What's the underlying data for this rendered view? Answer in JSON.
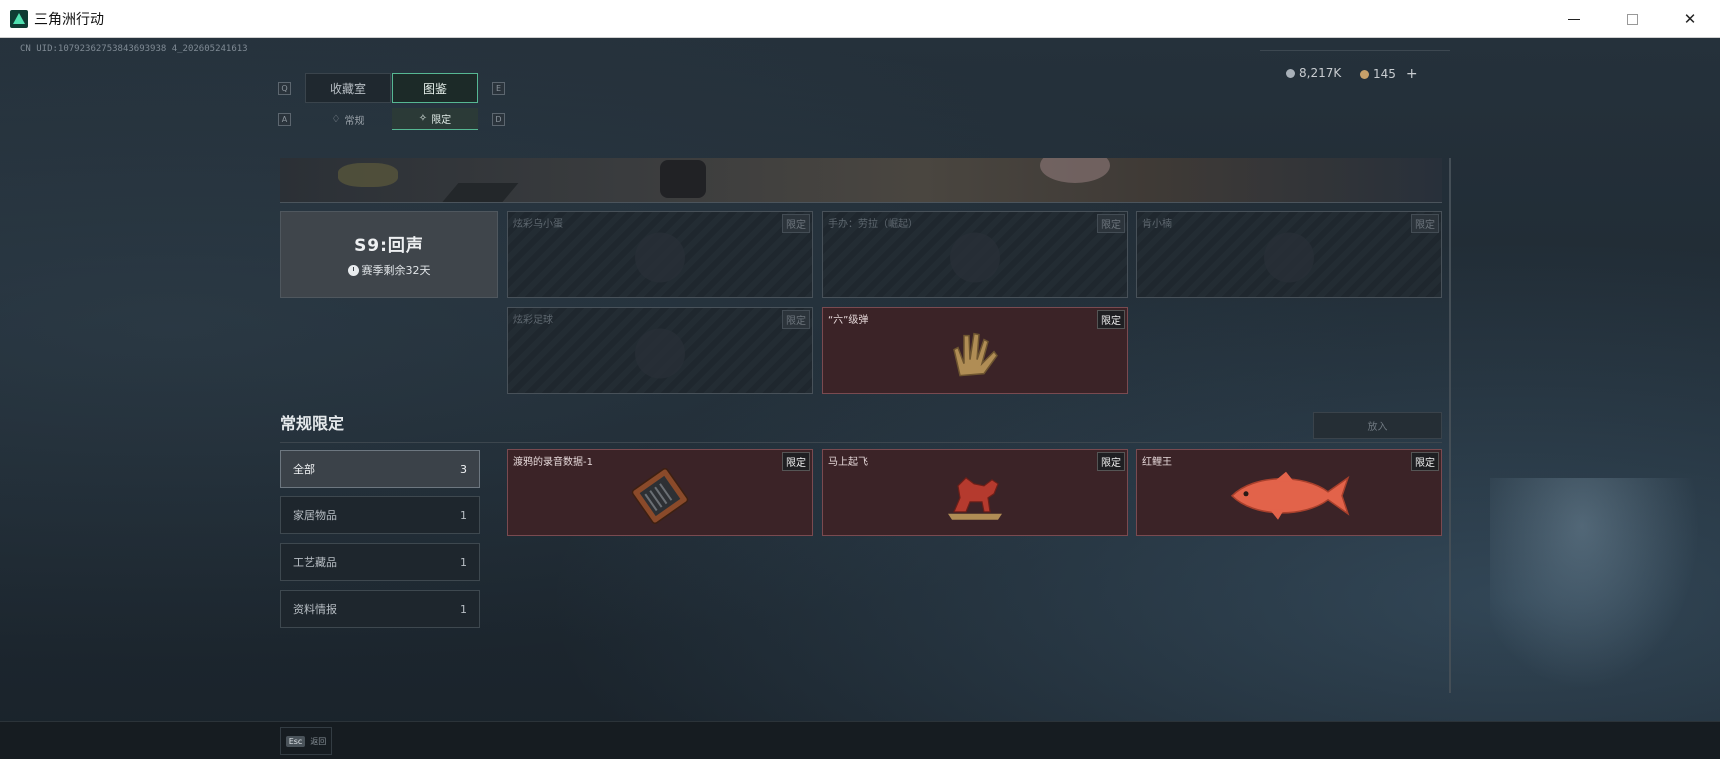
{
  "window": {
    "title": "三角洲行动",
    "min_icon": "minimize-icon",
    "max_icon": "maximize-icon",
    "close_label": "✕"
  },
  "uid": "CN UID:10792362753843693938 4_202605241613",
  "currency": {
    "silver": "8,217K",
    "gold": "145",
    "plus": "+"
  },
  "tabs": {
    "key_left": "Q",
    "key_right": "E",
    "main": [
      {
        "label": "收藏室"
      },
      {
        "label": "图鉴"
      }
    ],
    "sub_key_left": "A",
    "sub_key_right": "D",
    "sub": [
      {
        "label": "常规",
        "icon": "hand-icon"
      },
      {
        "label": "限定",
        "icon": "limited-icon"
      }
    ]
  },
  "season": {
    "title": "S9:回声",
    "remaining": "赛季剩余32天"
  },
  "season_items": [
    {
      "name": "炫彩乌小蛋",
      "badge": "限定",
      "owned": false
    },
    {
      "name": "手办：劳拉（崛起）",
      "badge": "限定",
      "owned": false
    },
    {
      "name": "肯小楠",
      "badge": "限定",
      "owned": false
    },
    {
      "name": "炫彩足球",
      "badge": "限定",
      "owned": false
    },
    {
      "name": "“六”级弹",
      "badge": "限定",
      "owned": true
    }
  ],
  "section": {
    "title": "常规限定",
    "put_button": "放入"
  },
  "categories": [
    {
      "label": "全部",
      "count": "3"
    },
    {
      "label": "家居物品",
      "count": "1"
    },
    {
      "label": "工艺藏品",
      "count": "1"
    },
    {
      "label": "资料情报",
      "count": "1"
    }
  ],
  "regular_items": [
    {
      "name": "渡鸦的录音数据-1",
      "badge": "限定",
      "owned": true
    },
    {
      "name": "马上起飞",
      "badge": "限定",
      "owned": true
    },
    {
      "name": "红鲤王",
      "badge": "限定",
      "owned": true
    }
  ],
  "footer": {
    "esc_key": "Esc",
    "esc_label": "返回"
  },
  "colors": {
    "accent": "#56b793",
    "owned_bg": "#3b2327",
    "bg": "#1b232b"
  }
}
